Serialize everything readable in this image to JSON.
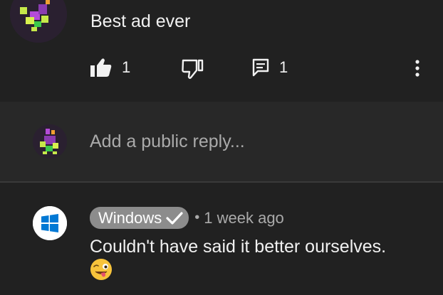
{
  "comment": {
    "text": "Best ad ever",
    "like_count": "1",
    "reply_count": "1",
    "icons": {
      "like": "thumbs-up-icon",
      "dislike": "thumbs-down-icon",
      "reply": "comment-icon",
      "more": "more-vert-icon"
    }
  },
  "reply_box": {
    "placeholder": "Add a public reply..."
  },
  "reply": {
    "author": "Windows",
    "verified_icon": "checkmark-icon",
    "separator": "•",
    "timestamp": "1 week ago",
    "text": "Couldn't have said it better ourselves.",
    "emoji_icon": "winking-face-with-tongue-icon"
  },
  "colors": {
    "background": "#212121",
    "reply_box_background": "#282828",
    "primary_text": "#f1f1f1",
    "secondary_text": "#aaaaaa",
    "author_chip": "#8c8c8c",
    "windows_blue": "#0078d4"
  }
}
